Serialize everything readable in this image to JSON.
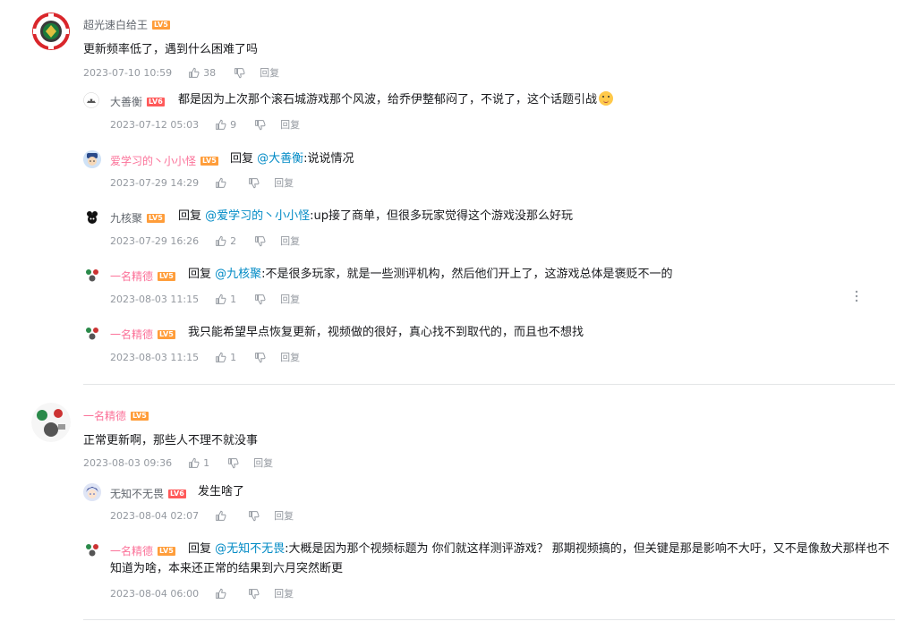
{
  "reply_label": "回复",
  "reply_prefix": "回复 ",
  "threads": [
    {
      "user": "超光速白给王",
      "level": "LV5",
      "text": "更新频率低了，遇到什么困难了吗",
      "time": "2023-07-10 10:59",
      "likes": "38",
      "replies": [
        {
          "user": "大善衡",
          "level": "LV6",
          "text": "都是因为上次那个滚石城游戏那个风波，给乔伊整郁闷了，不说了，这个话题引战",
          "time": "2023-07-12 05:03",
          "likes": "9"
        },
        {
          "user": "爱学习的丶小小怪",
          "level": "LV5",
          "reply_to": "@大善衡",
          "text": ":说说情况",
          "time": "2023-07-29 14:29",
          "likes": ""
        },
        {
          "user": "九核聚",
          "level": "LV5",
          "reply_to": "@爱学习的丶小小怪",
          "text": ":up接了商单，但很多玩家觉得这个游戏没那么好玩",
          "time": "2023-07-29 16:26",
          "likes": "2"
        },
        {
          "user": "一名精德",
          "level": "LV5",
          "reply_to": "@九核聚",
          "text": ":不是很多玩家，就是一些测评机构，然后他们开上了，这游戏总体是褒贬不一的",
          "time": "2023-08-03 11:15",
          "likes": "1"
        },
        {
          "user": "一名精德",
          "level": "LV5",
          "text": "我只能希望早点恢复更新，视频做的很好，真心找不到取代的，而且也不想找",
          "time": "2023-08-03 11:15",
          "likes": "1"
        }
      ]
    },
    {
      "user": "一名精德",
      "level": "LV5",
      "text": "正常更新啊，那些人不理不就没事",
      "time": "2023-08-03 09:36",
      "likes": "1",
      "replies": [
        {
          "user": "无知不无畏",
          "level": "LV6",
          "text": "发生啥了",
          "time": "2023-08-04 02:07",
          "likes": ""
        },
        {
          "user": "一名精德",
          "level": "LV5",
          "reply_to": "@无知不无畏",
          "text": ":大概是因为那个视频标题为 你们就这样测评游戏？ 那期视频搞的，但关键是那是影响不大吁，又不是像敖犬那样也不知道为啥，本来还正常的结果到六月突然断更",
          "time": "2023-08-04 06:00",
          "likes": ""
        }
      ]
    }
  ]
}
